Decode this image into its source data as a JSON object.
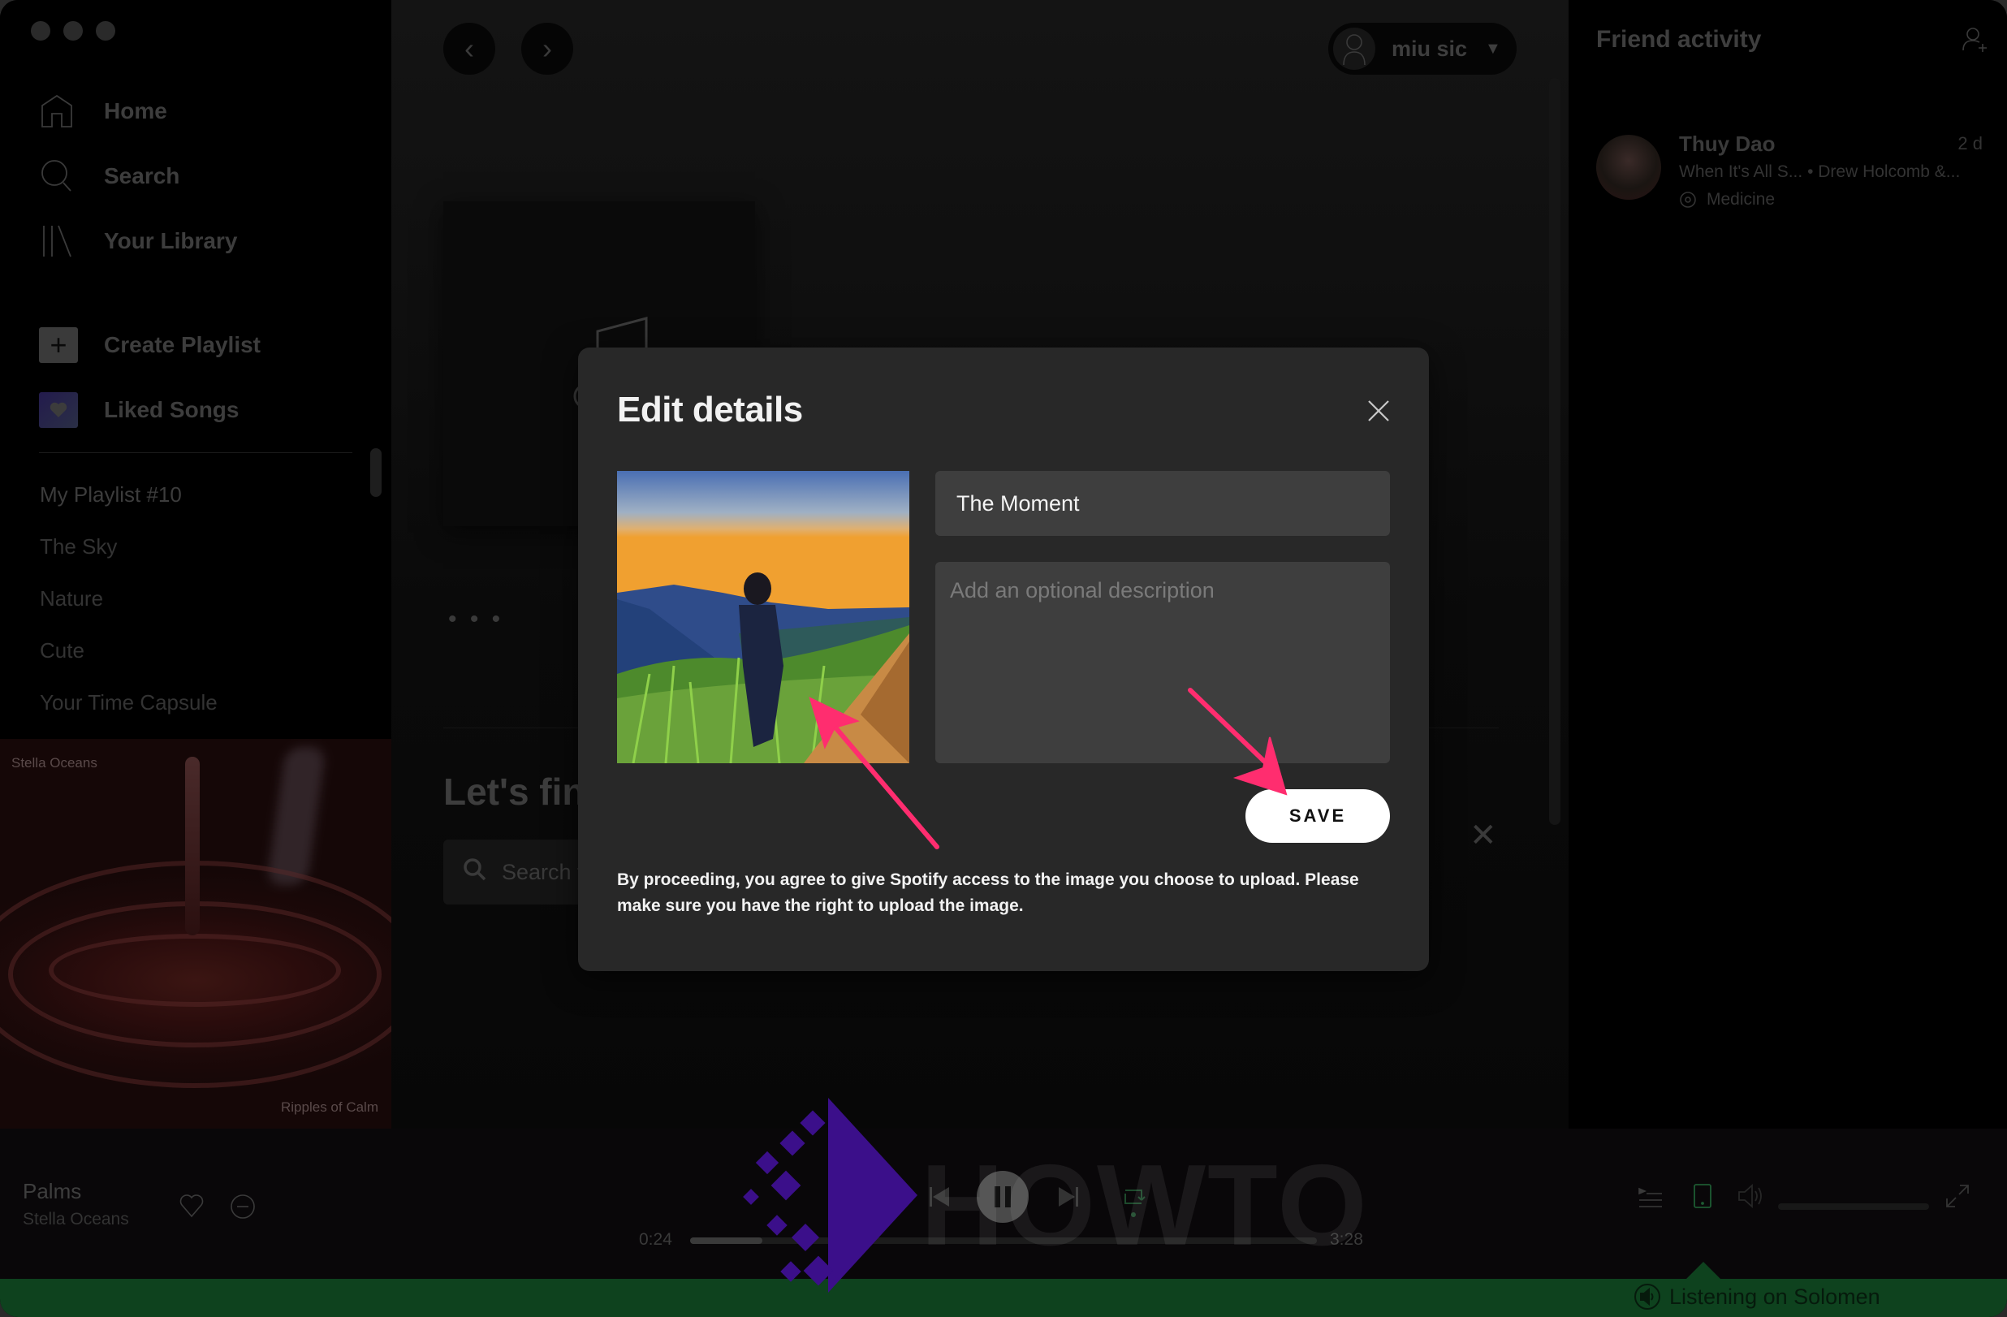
{
  "window": {
    "traffic_lights": [
      "close",
      "minimize",
      "zoom"
    ]
  },
  "sidebar": {
    "nav": [
      {
        "label": "Home",
        "icon": "home-icon"
      },
      {
        "label": "Search",
        "icon": "search-icon"
      },
      {
        "label": "Your Library",
        "icon": "library-icon"
      }
    ],
    "create_playlist": "Create Playlist",
    "liked_songs": "Liked Songs",
    "playlists": [
      "My Playlist #10",
      "The Sky",
      "Nature",
      "Cute",
      "Your Time Capsule"
    ],
    "album_art": {
      "artist": "Stella Oceans",
      "title": "Ripples of Calm"
    }
  },
  "topbar": {
    "back_icon": "‹",
    "forward_icon": "›",
    "user_name": "miu sic",
    "caret": "▼"
  },
  "main": {
    "more_dots": "• • •",
    "find_title": "Let's find something for your playlist",
    "find_search_placeholder": "Search for songs or episodes",
    "find_close": "✕"
  },
  "friends": {
    "title": "Friend activity",
    "items": [
      {
        "name": "Thuy Dao",
        "time": "2 d",
        "track": "When It's All S... • Drew Holcomb &...",
        "context": "Medicine"
      }
    ]
  },
  "modal": {
    "title": "Edit details",
    "name_value": "The Moment",
    "description_placeholder": "Add an optional description",
    "save_label": "SAVE",
    "disclaimer": "By proceeding, you agree to give Spotify access to the image you choose to upload. Please make sure you have the right to upload the image."
  },
  "player": {
    "track_title": "Palms",
    "track_artist": "Stella Oceans",
    "elapsed": "0:24",
    "duration": "3:28",
    "progress_fraction": 0.115,
    "volume_fraction": 0.0,
    "listening_on": "Listening on Solomen"
  },
  "watermark": {
    "text": "HOWTO"
  },
  "colors": {
    "annotation_arrow": "#ff2d6f",
    "listening_bar": "#0e421e",
    "modal_bg": "#282828",
    "field_bg": "#3e3e3e"
  }
}
